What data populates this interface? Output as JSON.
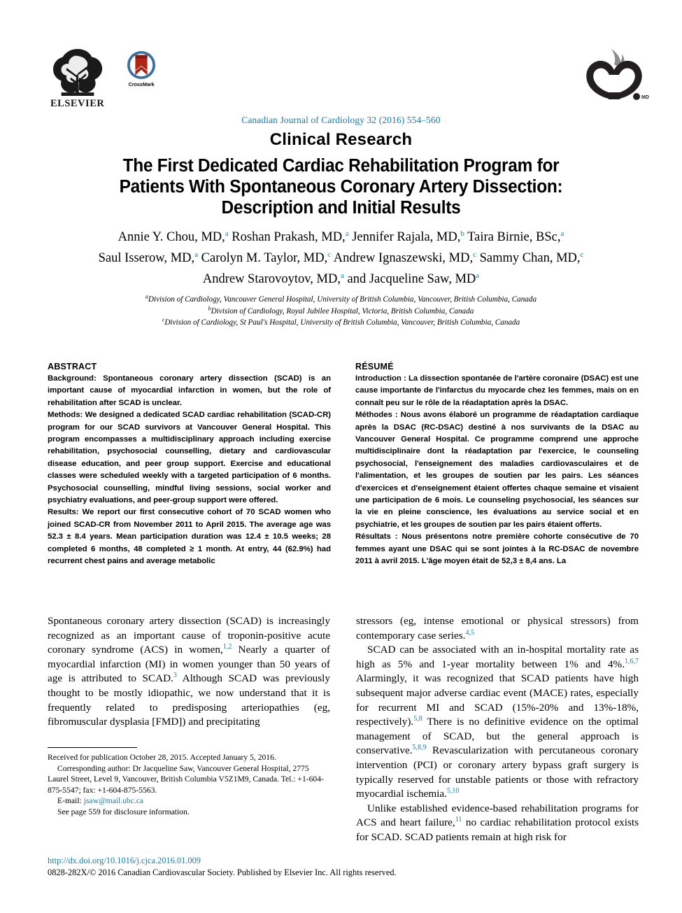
{
  "masthead": {
    "publisher_name": "ELSEVIER",
    "crossmark_label": "CrossMark",
    "publisher_icon": "elsevier-tree-icon",
    "crossmark_icon": "crossmark-badge-icon",
    "society_icon": "ccs-heart-flame-logo-icon"
  },
  "journal": {
    "citation_line": "Canadian Journal of Cardiology 32 (2016) 554–560",
    "accent_color": "#1a7ba4"
  },
  "section": {
    "name": "Clinical Research"
  },
  "title": {
    "line1": "The First Dedicated Cardiac Rehabilitation Program for",
    "line2": "Patients With Spontaneous Coronary Artery Dissection:",
    "line3": "Description and Initial Results"
  },
  "authors": {
    "line1": [
      {
        "name": "Annie Y. Chou, MD,",
        "sup": "a"
      },
      {
        "name": "Roshan Prakash, MD,",
        "sup": "a"
      },
      {
        "name": "Jennifer Rajala, MD,",
        "sup": "b"
      },
      {
        "name": "Taira Birnie, BSc,",
        "sup": "a"
      }
    ],
    "line2": [
      {
        "name": "Saul Isserow, MD,",
        "sup": "a"
      },
      {
        "name": "Carolyn M. Taylor, MD,",
        "sup": "c"
      },
      {
        "name": "Andrew Ignaszewski, MD,",
        "sup": "c"
      },
      {
        "name": "Sammy Chan, MD,",
        "sup": "c"
      }
    ],
    "line3": [
      {
        "name": "Andrew Starovoytov, MD,",
        "sup": "a"
      },
      {
        "name": "and Jacqueline Saw, MD",
        "sup": "a"
      }
    ]
  },
  "affiliations": [
    {
      "marker": "a",
      "text": "Division of Cardiology, Vancouver General Hospital, University of British Columbia, Vancouver, British Columbia, Canada"
    },
    {
      "marker": "b",
      "text": "Division of Cardiology, Royal Jubilee Hospital, Victoria, British Columbia, Canada"
    },
    {
      "marker": "c",
      "text": "Division of Cardiology, St Paul's Hospital, University of British Columbia, Vancouver, British Columbia, Canada"
    }
  ],
  "abstract": {
    "heading": "ABSTRACT",
    "background_label": "Background:",
    "background_text": " Spontaneous coronary artery dissection (SCAD) is an important cause of myocardial infarction in women, but the role of rehabilitation after SCAD is unclear.",
    "methods_label": "Methods:",
    "methods_text": " We designed a dedicated SCAD cardiac rehabilitation (SCAD-CR) program for our SCAD survivors at Vancouver General Hospital. This program encompasses a multidisciplinary approach including exercise rehabilitation, psychosocial counselling, dietary and cardiovascular disease education, and peer group support. Exercise and educational classes were scheduled weekly with a targeted participation of 6 months. Psychosocial counselling, mindful living sessions, social worker and psychiatry evaluations, and peer-group support were offered.",
    "results_label": "Results:",
    "results_text": " We report our first consecutive cohort of 70 SCAD women who joined SCAD-CR from November 2011 to April 2015. The average age was 52.3 ± 8.4 years. Mean participation duration was 12.4 ± 10.5 weeks; 28 completed 6 months, 48 completed ≥ 1 month. At entry, 44 (62.9%) had recurrent chest pains and average metabolic"
  },
  "resume": {
    "heading": "RÉSUMÉ",
    "intro_label": "Introduction :",
    "intro_text": " La dissection spontanée de l'artère coronaire (DSAC) est une cause importante de l'infarctus du myocarde chez les femmes, mais on en connaît peu sur le rôle de la réadaptation après la DSAC.",
    "methods_label": "Méthodes :",
    "methods_text": " Nous avons élaboré un programme de réadaptation cardiaque après la DSAC (RC-DSAC) destiné à nos survivants de la DSAC au Vancouver General Hospital. Ce programme comprend une approche multidisciplinaire dont la réadaptation par l'exercice, le counseling psychosocial, l'enseignement des maladies cardiovasculaires et de l'alimentation, et les groupes de soutien par les pairs. Les séances d'exercices et d'enseignement étaient offertes chaque semaine et visaient une participation de 6 mois. Le counseling psychosocial, les séances sur la vie en pleine conscience, les évaluations au service social et en psychiatrie, et les groupes de soutien par les pairs étaient offerts.",
    "results_label": "Résultats :",
    "results_text": " Nous présentons notre première cohorte consécutive de 70 femmes ayant une DSAC qui se sont jointes à la RC-DSAC de novembre 2011 à avril 2015. L'âge moyen était de 52,3 ± 8,4 ans. La"
  },
  "body": {
    "left_p1_a": "Spontaneous coronary artery dissection (SCAD) is increasingly recognized as an important cause of troponin-positive acute coronary syndrome (ACS) in women,",
    "left_p1_sup1": "1,2",
    "left_p1_b": " Nearly a quarter of myocardial infarction (MI) in women younger than 50 years of age is attributed to SCAD.",
    "left_p1_sup2": "3",
    "left_p1_c": " Although SCAD was previously thought to be mostly idiopathic, we now understand that it is frequently related to predisposing arteriopathies (eg, fibromuscular dysplasia [FMD]) and precipitating",
    "right_p1_a": "stressors (eg, intense emotional or physical stressors) from contemporary case series.",
    "right_p1_sup": "4,5",
    "right_p2_a": "SCAD can be associated with an in-hospital mortality rate as high as 5% and 1-year mortality between 1% and 4%.",
    "right_p2_sup1": "1,6,7",
    "right_p2_b": " Alarmingly, it was recognized that SCAD patients have high subsequent major adverse cardiac event (MACE) rates, especially for recurrent MI and SCAD (15%-20% and 13%-18%, respectively).",
    "right_p2_sup2": "5,8",
    "right_p2_c": " There is no definitive evidence on the optimal management of SCAD, but the general approach is conservative.",
    "right_p2_sup3": "5,8,9",
    "right_p2_d": " Revascularization with percutaneous coronary intervention (PCI) or coronary artery bypass graft surgery is typically reserved for unstable patients or those with refractory myocardial ischemia.",
    "right_p2_sup4": "5,10",
    "right_p3_a": "Unlike established evidence-based rehabilitation programs for ACS and heart failure,",
    "right_p3_sup": "11",
    "right_p3_b": " no cardiac rehabilitation protocol exists for SCAD. SCAD patients remain at high risk for"
  },
  "footnotes": {
    "received": "Received for publication October 28, 2015. Accepted January 5, 2016.",
    "corresponding": "Corresponding author: Dr Jacqueline Saw, Vancouver General Hospital, 2775 Laurel Street, Level 9, Vancouver, British Columbia V5Z1M9, Canada. Tel.: +1-604-875-5547; fax: +1-604-875-5563.",
    "email_label": "E-mail:",
    "email": "jsaw@mail.ubc.ca",
    "disclosure": "See page 559 for disclosure information."
  },
  "footer": {
    "doi": "http://dx.doi.org/10.1016/j.cjca.2016.01.009",
    "copyright": "0828-282X/© 2016 Canadian Cardiovascular Society. Published by Elsevier Inc. All rights reserved."
  }
}
